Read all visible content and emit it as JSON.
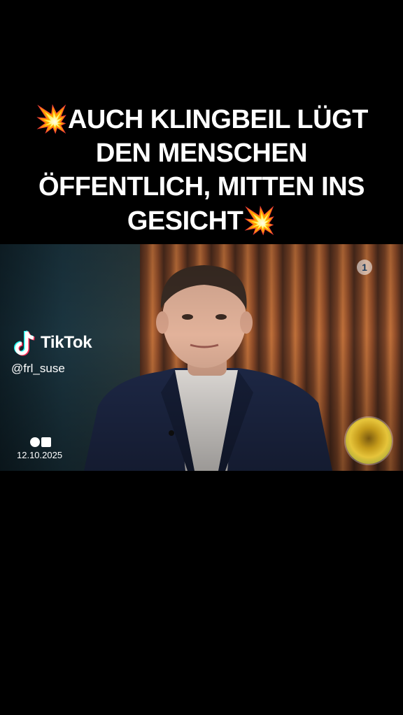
{
  "caption": {
    "lines": [
      "AUCH KLINGBEIL LÜGT",
      "DEN MENSCHEN",
      "ÖFFENTLICH, MITTEN INS",
      "GESICHT"
    ],
    "emoji": "💥"
  },
  "overlay": {
    "brand": "TikTok",
    "handle": "@frl_suse",
    "date": "12.10.2025",
    "channel_logo": "1"
  },
  "icons": {
    "brand_icon": "tiktok-note-icon",
    "watermark_icon": "zdf-style-logo-icon",
    "broadcaster_icon": "ard-logo-icon",
    "avatar_icon": "sunflower-avatar"
  },
  "colors": {
    "background": "#000000",
    "text": "#ffffff",
    "tiktok_cyan": "#25f4ee",
    "tiktok_pink": "#fe2c55",
    "suit": "#1f2a4a"
  }
}
